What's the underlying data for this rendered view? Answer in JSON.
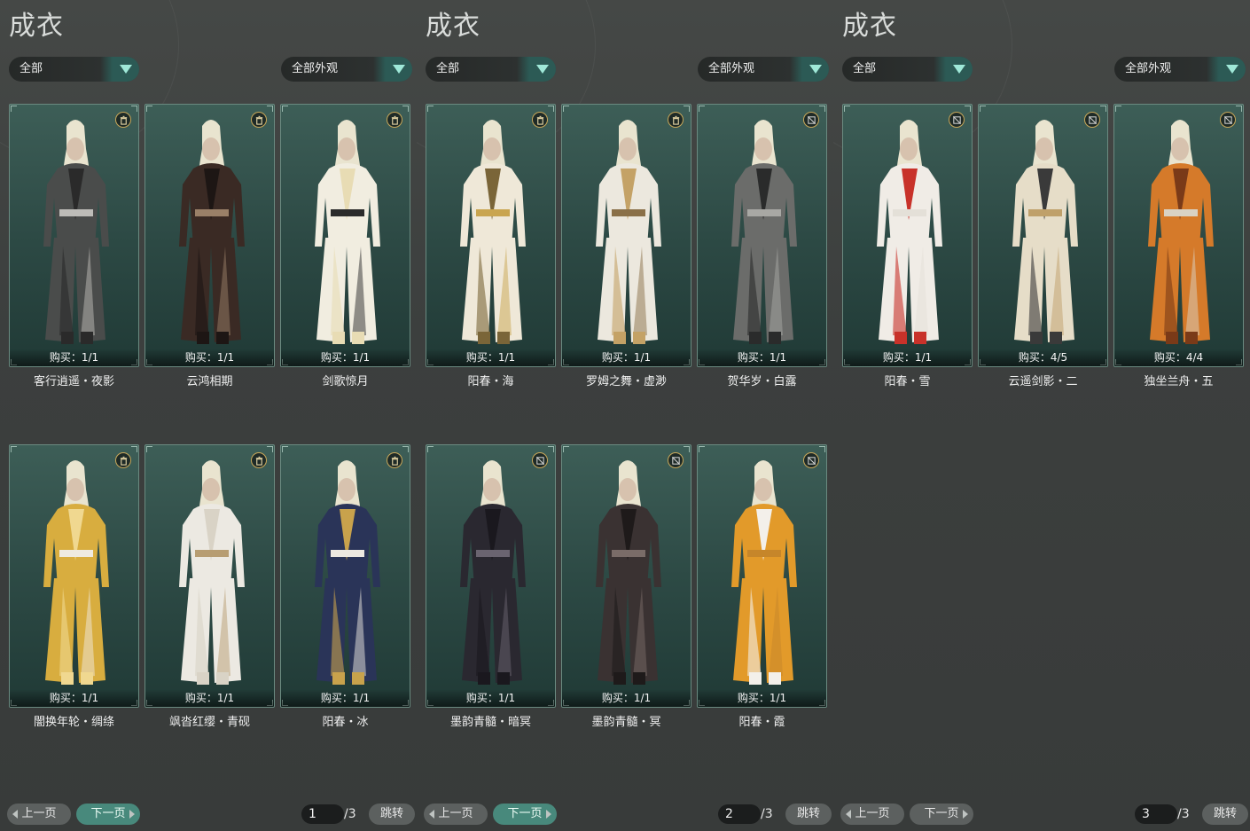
{
  "panels": [
    {
      "title": "成衣",
      "filter1": "全部",
      "filter2": "全部外观",
      "cards": [
        {
          "name": "客行逍遥・夜影",
          "buy": "购买：1/1",
          "icon": "trash-icon",
          "palette": [
            "#4a4c4b",
            "#2a2a2a",
            "#bdbcb8"
          ]
        },
        {
          "name": "云鸿相期",
          "buy": "购买：1/1",
          "icon": "trash-icon",
          "palette": [
            "#3a2a24",
            "#1d1614",
            "#9a8068"
          ]
        },
        {
          "name": "剑歌惊月",
          "buy": "购买：1/1",
          "icon": "trash-icon",
          "palette": [
            "#f1ede0",
            "#e8dcb4",
            "#2b2b2b"
          ]
        },
        {
          "name": "闇换年轮・绸绦",
          "buy": "购买：1/1",
          "icon": "trash-icon",
          "palette": [
            "#d8ad3f",
            "#f0d890",
            "#efeae0"
          ]
        },
        {
          "name": "飒沓红缨・青砚",
          "buy": "购买：1/1",
          "icon": "trash-icon",
          "palette": [
            "#ece9e2",
            "#d9d3c6",
            "#b79d72"
          ]
        },
        {
          "name": "阳春・冰",
          "buy": "购买：1/1",
          "icon": "trash-icon",
          "palette": [
            "#2a3458",
            "#c8a24c",
            "#ece8e0"
          ]
        }
      ],
      "prev": "上一页",
      "next": "下一页",
      "page": "1",
      "total": "/3",
      "jump": "跳转"
    },
    {
      "title": "成衣",
      "filter1": "全部",
      "filter2": "全部外观",
      "cards": [
        {
          "name": "阳春・海",
          "buy": "购买：1/1",
          "icon": "trash-icon",
          "palette": [
            "#efe8d8",
            "#7a6538",
            "#c9a550"
          ]
        },
        {
          "name": "罗姆之舞・虚渺",
          "buy": "购买：1/1",
          "icon": "trash-icon",
          "palette": [
            "#ece8de",
            "#c4a266",
            "#8a7048"
          ]
        },
        {
          "name": "贺华岁・白露",
          "buy": "购买：1/1",
          "icon": "no-trade-icon",
          "palette": [
            "#6b6c6a",
            "#2a2b2b",
            "#a8a8a4"
          ]
        },
        {
          "name": "墨韵青髓・暗冥",
          "buy": "购买：1/1",
          "icon": "no-trade-icon",
          "palette": [
            "#2a2830",
            "#1a181e",
            "#6a6470"
          ]
        },
        {
          "name": "墨韵青髓・冥",
          "buy": "购买：1/1",
          "icon": "no-trade-icon",
          "palette": [
            "#3a3232",
            "#1e1a1a",
            "#7a6c68"
          ]
        },
        {
          "name": "阳春・霞",
          "buy": "购买：1/1",
          "icon": "no-trade-icon",
          "palette": [
            "#e29a2a",
            "#f3f0ea",
            "#c6862a"
          ]
        }
      ],
      "prev": "上一页",
      "next": "下一页",
      "page": "2",
      "total": "/3",
      "jump": "跳转"
    },
    {
      "title": "成衣",
      "filter1": "全部",
      "filter2": "全部外观",
      "cards": [
        {
          "name": "阳春・雪",
          "buy": "购买：1/1",
          "icon": "no-trade-icon",
          "palette": [
            "#f0ece6",
            "#c8322a",
            "#e4e0d8"
          ]
        },
        {
          "name": "云遥剑影・二",
          "buy": "购买：4/5",
          "icon": "no-trade-icon",
          "palette": [
            "#e6ddc8",
            "#3a3a3a",
            "#bfa06a"
          ]
        },
        {
          "name": "独坐兰舟・五",
          "buy": "购买：4/4",
          "icon": "no-trade-icon",
          "palette": [
            "#d57a2a",
            "#7a3a18",
            "#d9d2c4"
          ]
        }
      ],
      "prev": "上一页",
      "next": "下一页",
      "page": "3",
      "total": "/3",
      "jump": "跳转"
    }
  ]
}
